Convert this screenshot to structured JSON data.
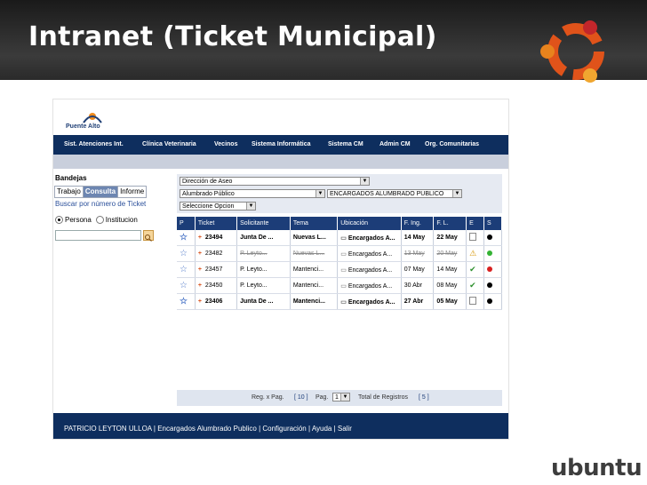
{
  "slide": {
    "title": "Intranet (Ticket Municipal)",
    "ubuntu_word": "ubuntu"
  },
  "app": {
    "brand": "Puente Alto",
    "nav": [
      "Sist. Atenciones Int.",
      "Clínica Veterinaria",
      "Vecinos",
      "Sistema Informática",
      "Sistema CM",
      "Admin CM",
      "Org. Comunitarias"
    ],
    "sidebar": {
      "title": "Bandejas",
      "tabs": [
        "Trabajo",
        "Consulta",
        "Informe"
      ],
      "active_tab": "Consulta",
      "search_link": "Buscar por número de Ticket",
      "radio_persona": "Persona",
      "radio_institucion": "Institucion"
    },
    "filters": {
      "direccion": "Dirección de Aseo",
      "area": "Alumbrado Público",
      "encargados": "ENCARGADOS ALUMBRADO PUBLICO",
      "opcion": "Seleccione Opcion"
    },
    "grid": {
      "headers": [
        "P",
        "Ticket",
        "Solicitante",
        "Tema",
        "Ubicación",
        "F. Ing.",
        "F. L.",
        "E",
        "S"
      ],
      "rows": [
        {
          "ticket": "23494",
          "solicitante": "Junta De ...",
          "tema": "Nuevas L...",
          "ubicacion": "Encargados A...",
          "fing": "14 May",
          "fl": "22 May",
          "estado": "doc",
          "status_color": "#000000",
          "style": "unread"
        },
        {
          "ticket": "23482",
          "solicitante": "P. Leyto...",
          "tema": "Nuevas L...",
          "ubicacion": "Encargados A...",
          "fing": "13 May",
          "fl": "20 May",
          "estado": "warn",
          "status_color": "#33b233",
          "style": "struck"
        },
        {
          "ticket": "23457",
          "solicitante": "P. Leyto...",
          "tema": "Mantenci...",
          "ubicacion": "Encargados A...",
          "fing": "07 May",
          "fl": "14 May",
          "estado": "check",
          "status_color": "#d82020",
          "style": "normal"
        },
        {
          "ticket": "23450",
          "solicitante": "P. Leyto...",
          "tema": "Mantenci...",
          "ubicacion": "Encargados A...",
          "fing": "30 Abr",
          "fl": "08 May",
          "estado": "check",
          "status_color": "#000000",
          "style": "normal"
        },
        {
          "ticket": "23406",
          "solicitante": "Junta De ...",
          "tema": "Mantenci...",
          "ubicacion": "Encargados A...",
          "fing": "27 Abr",
          "fl": "05 May",
          "estado": "doc",
          "status_color": "#000000",
          "style": "unread"
        }
      ]
    },
    "pager": {
      "reg_label": "Reg. x Pag.",
      "reg_value": "[ 10 ]",
      "pag_label": "Pag.",
      "pag_value": "1",
      "total_label": "Total de Registros",
      "total_value": "[ 5 ]"
    },
    "footer": "PATRICIO LEYTON ULLOA | Encargados Alumbrado Publico | Configuración | Ayuda | Salir"
  }
}
